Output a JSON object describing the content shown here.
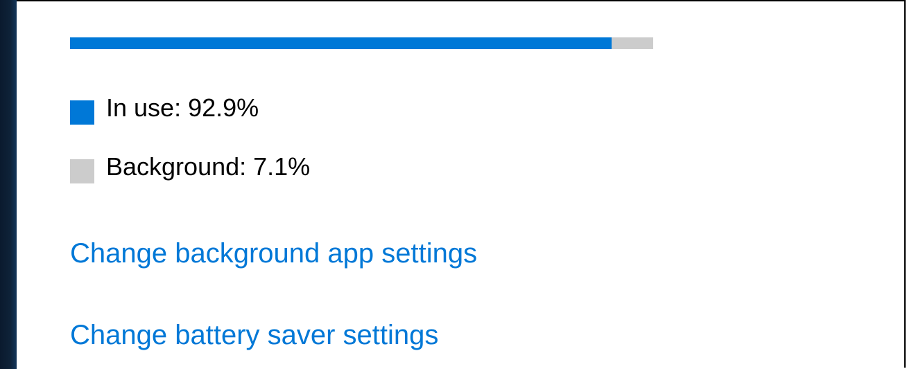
{
  "usage": {
    "in_use_fraction": 0.929,
    "background_fraction": 0.071,
    "in_use_color": "#0078d7",
    "background_color": "#cccccc"
  },
  "legend": {
    "in_use_label": "In use: 92.9%",
    "background_label": "Background: 7.1%"
  },
  "links": {
    "background_apps": "Change background app settings",
    "battery_saver": "Change battery saver settings"
  }
}
